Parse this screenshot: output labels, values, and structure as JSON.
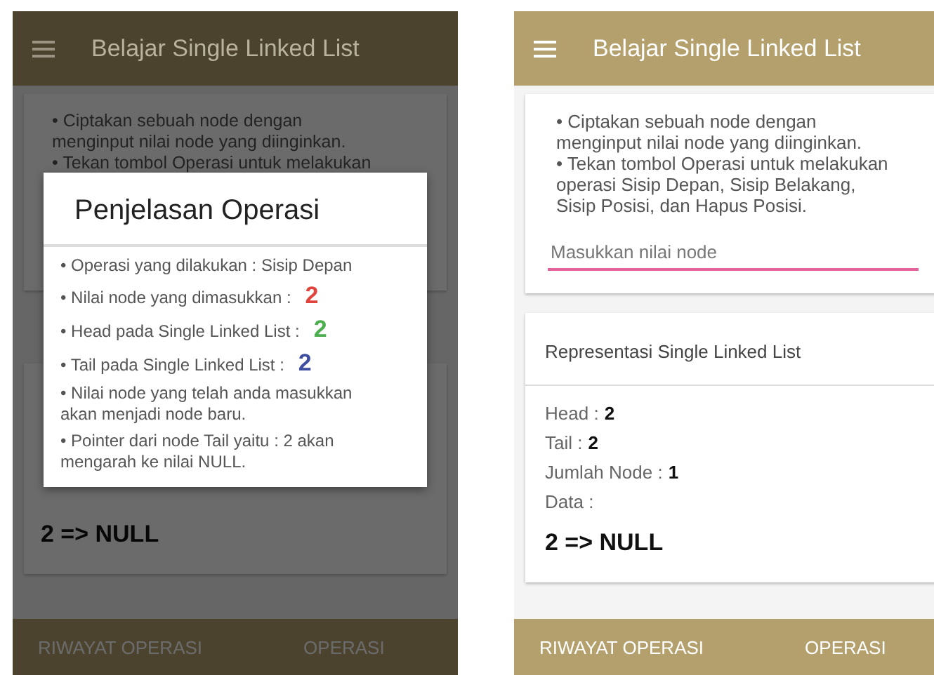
{
  "left_screen": {
    "app_bar": {
      "title": "Belajar Single Linked List"
    },
    "intro_lines": [
      "•  Ciptakan sebuah node dengan menginput nilai node yang diinginkan.",
      "•  Tekan tombol Operasi untuk melakukan"
    ],
    "data_text": "2 => NULL",
    "bottom_bar": [
      "RIWAYAT OPERASI",
      "OPERASI"
    ],
    "dialog": {
      "title": "Penjelasan Operasi",
      "items": [
        {
          "text": "• Operasi yang dilakukan : Sisip Depan"
        },
        {
          "text": "•  Nilai node yang dimasukkan :",
          "value": "2",
          "color": "#e0443c"
        },
        {
          "text": "•  Head pada Single Linked List :",
          "value": "2",
          "color": "#4cae4f"
        },
        {
          "text": "•  Tail pada Single Linked List :",
          "value": "2",
          "color": "#3f4fa0"
        },
        {
          "text": "•  Nilai node yang telah anda masukkan akan menjadi node baru."
        },
        {
          "text": "• Pointer dari node Tail yaitu : 2 akan mengarah ke nilai NULL."
        }
      ]
    }
  },
  "right_screen": {
    "app_bar": {
      "title": "Belajar Single Linked List"
    },
    "intro_lines": [
      "•  Ciptakan sebuah node dengan menginput nilai node yang diinginkan.",
      "•  Tekan tombol Operasi untuk melakukan operasi Sisip Depan, Sisip Belakang, Sisip Posisi, dan Hapus Posisi."
    ],
    "input": {
      "placeholder": "Masukkan nilai node"
    },
    "card_title": "Representasi Single Linked List",
    "stats": [
      {
        "label": "Head :",
        "value": "2"
      },
      {
        "label": "Tail :",
        "value": "2"
      },
      {
        "label": "Jumlah Node :",
        "value": "1"
      },
      {
        "label": "Data :"
      }
    ],
    "data_text": "2 => NULL",
    "bottom_bar": [
      "RIWAYAT OPERASI",
      "OPERASI"
    ]
  }
}
